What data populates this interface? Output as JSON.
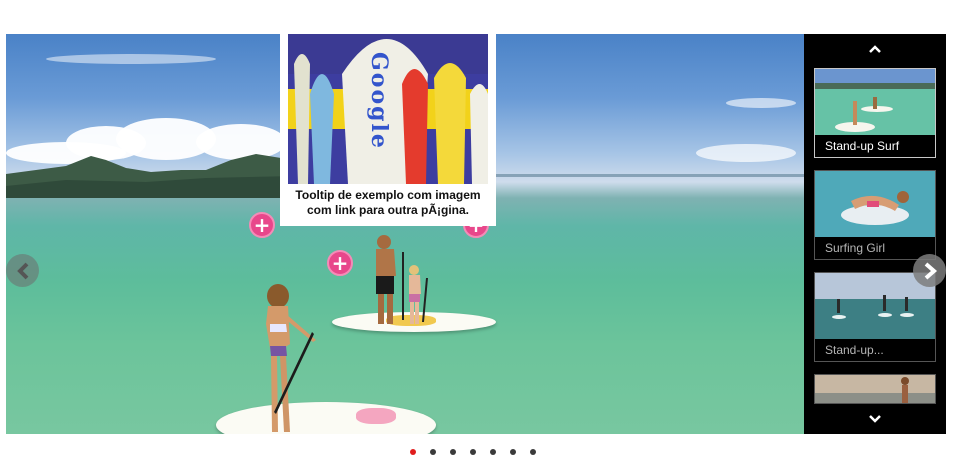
{
  "slider": {
    "prev_icon": "chevron-left-icon",
    "next_icon": "chevron-right-icon",
    "hotspot_glyph": "+"
  },
  "tooltip": {
    "image_text": "Google",
    "text": "Tooltip de exemplo com imagem com link para outra pÃ¡gina."
  },
  "thumbnails": {
    "up_icon": "chevron-up-icon",
    "down_icon": "chevron-down-icon",
    "items": [
      {
        "label": "Stand-up Surf",
        "active": true
      },
      {
        "label": "Surfing Girl",
        "active": false
      },
      {
        "label": "Stand-up...",
        "active": false
      },
      {
        "label": "",
        "active": false
      }
    ]
  },
  "bullets": {
    "count": 7,
    "active_index": 0
  },
  "colors": {
    "hotspot": "#e8478b",
    "bullet_active": "#e01d1d",
    "panel_bg": "#000000"
  }
}
